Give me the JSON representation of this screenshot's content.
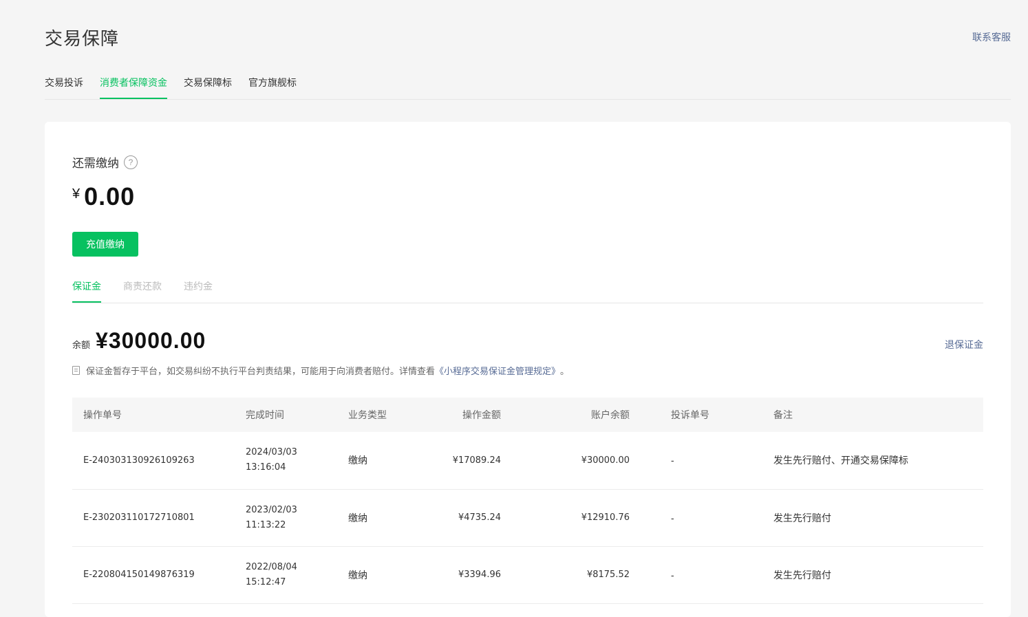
{
  "header": {
    "title": "交易保障",
    "contact_label": "联系客服"
  },
  "main_tabs": [
    {
      "label": "交易投诉",
      "active": false
    },
    {
      "label": "消费者保障资金",
      "active": true
    },
    {
      "label": "交易保障标",
      "active": false
    },
    {
      "label": "官方旗舰标",
      "active": false
    }
  ],
  "due": {
    "label": "还需缴纳",
    "help_icon": "question-circle-icon",
    "currency": "¥",
    "amount": "0.00",
    "recharge_label": "充值缴纳"
  },
  "sub_tabs": [
    {
      "label": "保证金",
      "active": true
    },
    {
      "label": "商责还款",
      "active": false
    },
    {
      "label": "违约金",
      "active": false
    }
  ],
  "balance": {
    "label": "余额",
    "value": "¥30000.00",
    "refund_label": "退保证金"
  },
  "notice": {
    "icon": "document-icon",
    "text": "保证金暂存于平台，如交易纠纷不执行平台判责结果，可能用于向消费者赔付。详情查看",
    "link_text": "《小程序交易保证金管理规定》",
    "suffix": "。"
  },
  "table": {
    "headers": [
      "操作单号",
      "完成时间",
      "业务类型",
      "操作金额",
      "账户余额",
      "投诉单号",
      "备注"
    ],
    "rows": [
      {
        "id": "E-240303130926109263",
        "date": "2024/03/03",
        "time": "13:16:04",
        "type": "缴纳",
        "amount": "¥17089.24",
        "balance": "¥30000.00",
        "complaint": "-",
        "note": "发生先行赔付、开通交易保障标"
      },
      {
        "id": "E-230203110172710801",
        "date": "2023/02/03",
        "time": "11:13:22",
        "type": "缴纳",
        "amount": "¥4735.24",
        "balance": "¥12910.76",
        "complaint": "-",
        "note": "发生先行赔付"
      },
      {
        "id": "E-220804150149876319",
        "date": "2022/08/04",
        "time": "15:12:47",
        "type": "缴纳",
        "amount": "¥3394.96",
        "balance": "¥8175.52",
        "complaint": "-",
        "note": "发生先行赔付"
      }
    ]
  },
  "colors": {
    "accent": "#07c160",
    "link": "#576b95",
    "background": "#f5f5f5"
  }
}
